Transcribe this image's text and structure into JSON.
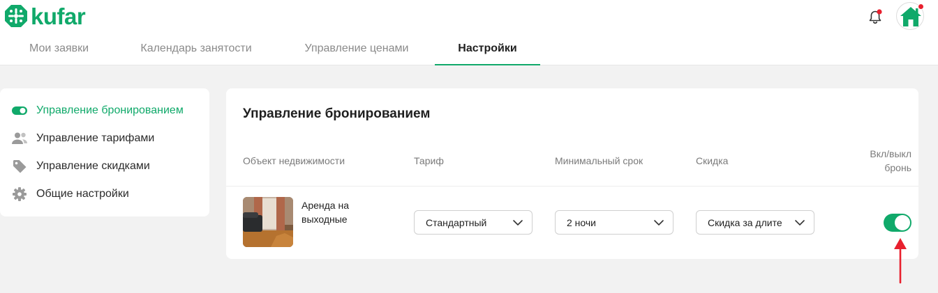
{
  "brand": {
    "logo_text": "kufar",
    "color": "#10a96a"
  },
  "header": {
    "bell_icon": "bell-icon",
    "bell_badge_color": "#e8202e",
    "avatar_icon": "house-icon"
  },
  "tabs": [
    {
      "label": "Мои заявки",
      "active": false
    },
    {
      "label": "Календарь занятости",
      "active": false
    },
    {
      "label": "Управление ценами",
      "active": false
    },
    {
      "label": "Настройки",
      "active": true
    }
  ],
  "sidebar": {
    "items": [
      {
        "label": "Управление бронированием",
        "icon": "toggle-icon",
        "active": true
      },
      {
        "label": "Управление тарифами",
        "icon": "users-icon",
        "active": false
      },
      {
        "label": "Управление скидками",
        "icon": "tag-icon",
        "active": false
      },
      {
        "label": "Общие настройки",
        "icon": "gear-icon",
        "active": false
      }
    ]
  },
  "main": {
    "title": "Управление бронированием",
    "columns": {
      "property": "Объект недвижимости",
      "tariff": "Тариф",
      "min_term": "Минимальный срок",
      "discount": "Скидка",
      "toggle_line1": "Вкл/выкл",
      "toggle_line2": "бронь"
    },
    "rows": [
      {
        "property_name": "Аренда на выходные",
        "tariff_value": "Стандартный",
        "min_term_value": "2 ночи",
        "discount_value": "Скидка за длите",
        "booking_enabled": true
      }
    ]
  },
  "annotation": {
    "arrow_color": "#e8202e"
  }
}
